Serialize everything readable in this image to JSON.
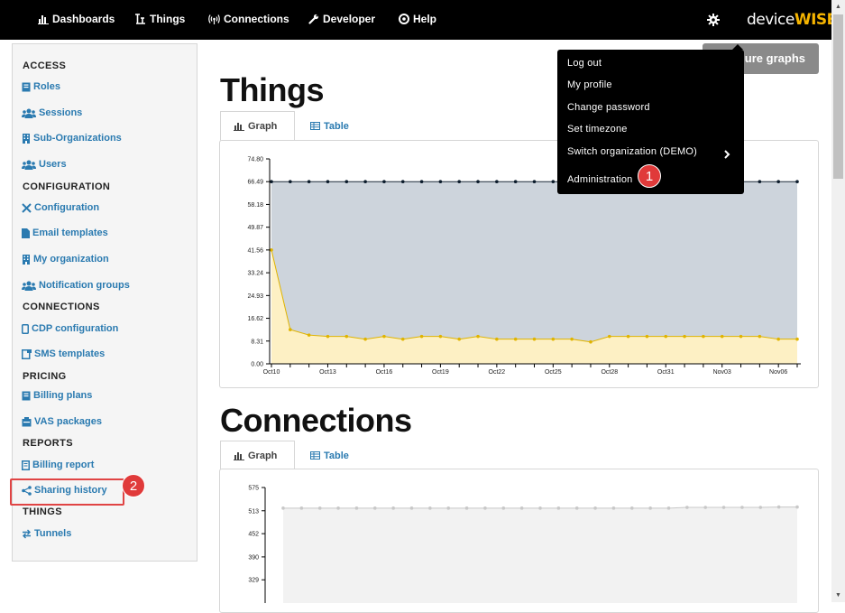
{
  "topnav": {
    "items": [
      {
        "label": "Dashboards",
        "icon": "bar-chart-icon"
      },
      {
        "label": "Things",
        "icon": "things-icon"
      },
      {
        "label": "Connections",
        "icon": "wireless-icon"
      },
      {
        "label": "Developer",
        "icon": "wrench-icon"
      },
      {
        "label": "Help",
        "icon": "help-icon"
      }
    ],
    "logo_part1": "device",
    "logo_part2": "WISE",
    "settings_icon": "gear-icon"
  },
  "sidebar": {
    "sections": [
      {
        "heading": "ACCESS",
        "items": [
          {
            "label": "Roles",
            "icon": "book-icon"
          },
          {
            "label": "Sessions",
            "icon": "users-icon"
          },
          {
            "label": "Sub-Organizations",
            "icon": "building-icon"
          },
          {
            "label": "Users",
            "icon": "users-icon"
          }
        ]
      },
      {
        "heading": "CONFIGURATION",
        "items": [
          {
            "label": "Configuration",
            "icon": "tools-icon"
          },
          {
            "label": "Email templates",
            "icon": "file-icon"
          },
          {
            "label": "My organization",
            "icon": "building-icon"
          },
          {
            "label": "Notification groups",
            "icon": "users-icon"
          }
        ]
      },
      {
        "heading": "CONNECTIONS",
        "items": [
          {
            "label": "CDP configuration",
            "icon": "mobile-icon"
          },
          {
            "label": "SMS templates",
            "icon": "sms-icon"
          }
        ]
      },
      {
        "heading": "PRICING",
        "items": [
          {
            "label": "Billing plans",
            "icon": "book-icon"
          },
          {
            "label": "VAS packages",
            "icon": "package-icon"
          }
        ]
      },
      {
        "heading": "REPORTS",
        "items": [
          {
            "label": "Billing report",
            "icon": "document-icon"
          },
          {
            "label": "Sharing history",
            "icon": "share-icon"
          }
        ]
      },
      {
        "heading": "THINGS",
        "items": [
          {
            "label": "Tunnels",
            "icon": "exchange-icon"
          }
        ]
      }
    ]
  },
  "annotations": [
    "1",
    "2"
  ],
  "main": {
    "things": {
      "title": "Things",
      "tabs": [
        {
          "label": "Graph",
          "icon": "bar-chart-icon"
        },
        {
          "label": "Table",
          "icon": "table-icon"
        }
      ]
    },
    "connections": {
      "title": "Connections",
      "tabs": [
        {
          "label": "Graph",
          "icon": "bar-chart-icon"
        },
        {
          "label": "Table",
          "icon": "table-icon"
        }
      ]
    },
    "configure_button": "Configure graphs"
  },
  "dropdown": {
    "items": [
      "Log out",
      "My profile",
      "Change password",
      "Set timezone",
      "Switch organization (DEMO)",
      "Administration"
    ]
  },
  "colors": {
    "nav_bg": "#000000",
    "link": "#2a7ab0",
    "badge": "#e03a3a",
    "upper_fill": "#cdd4dc",
    "lower_fill": "#fdf0c4",
    "yellow_line": "#e0b400"
  },
  "chart_data": [
    {
      "type": "area",
      "ylim": [
        0.0,
        74.8
      ],
      "yticks": [
        "74.80",
        "66.49",
        "58.18",
        "49.87",
        "41.56",
        "33.24",
        "24.93",
        "16.62",
        "8.31",
        "0.00"
      ],
      "x": [
        "Oct10",
        "Oct11",
        "Oct12",
        "Oct13",
        "Oct14",
        "Oct15",
        "Oct16",
        "Oct17",
        "Oct18",
        "Oct19",
        "Oct20",
        "Oct21",
        "Oct22",
        "Oct23",
        "Oct24",
        "Oct25",
        "Oct26",
        "Oct27",
        "Oct28",
        "Oct29",
        "Oct30",
        "Oct31",
        "Nov01",
        "Nov02",
        "Nov03",
        "Nov04",
        "Nov05",
        "Nov06",
        "Nov07"
      ],
      "xticks": [
        "Oct10",
        "Oct13",
        "Oct16",
        "Oct19",
        "Oct22",
        "Oct25",
        "Oct28",
        "Oct31",
        "Nov03",
        "Nov06"
      ],
      "series": [
        {
          "values": [
            66.49,
            66.49,
            66.49,
            66.49,
            66.49,
            66.49,
            66.49,
            66.49,
            66.49,
            66.49,
            66.49,
            66.49,
            66.49,
            66.49,
            66.49,
            66.49,
            66.49,
            66.49,
            66.49,
            66.49,
            66.49,
            66.49,
            66.49,
            66.49,
            66.49,
            66.49,
            66.49,
            66.49,
            66.49
          ]
        },
        {
          "values": [
            41.56,
            12.5,
            10.5,
            10,
            10,
            9,
            10,
            9,
            10,
            10,
            9,
            10,
            9,
            9,
            9,
            9,
            9,
            8,
            10,
            10,
            10,
            10,
            10,
            10,
            10,
            10,
            10,
            9,
            9
          ]
        }
      ]
    },
    {
      "type": "area",
      "ylim": [
        267,
        575
      ],
      "yticks": [
        "575",
        "513",
        "452",
        "390",
        "329"
      ],
      "series": [
        {
          "values": [
            520,
            520,
            520,
            520,
            520,
            520,
            520,
            520,
            520,
            520,
            520,
            520,
            520,
            520,
            520,
            520,
            520,
            520,
            520,
            520,
            520,
            520,
            522,
            522,
            522,
            522,
            522,
            523,
            523
          ]
        }
      ]
    }
  ]
}
